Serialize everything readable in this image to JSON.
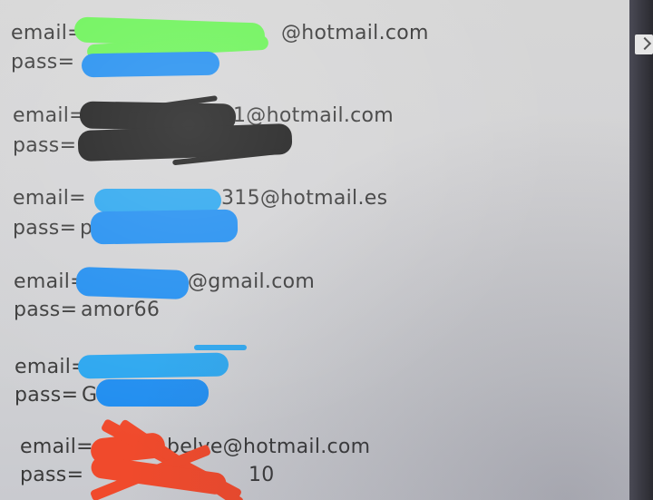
{
  "records": [
    {
      "email_label": "email=",
      "email_tail": "@hotmail.com",
      "pass_label": "pass=",
      "pass_value": "",
      "redaction_color": "#6af356"
    },
    {
      "email_label": "email=",
      "email_tail": "1@hotmail.com",
      "pass_label": "pass=",
      "pass_value": "",
      "redaction_color": "#1a1a1a"
    },
    {
      "email_label": "email=",
      "email_tail": "315@hotmail.es",
      "pass_label": "pass=",
      "pass_value": "p",
      "redaction_color": "#1f8df0"
    },
    {
      "email_label": "email=",
      "email_tail": "@gmail.com",
      "pass_label": "pass=",
      "pass_value": "amor66",
      "redaction_color": "#1f8df0"
    },
    {
      "email_label": "email=",
      "email_tail": "",
      "pass_label": "pass=",
      "pass_value": "G",
      "redaction_color": "#2aa6ef"
    },
    {
      "email_label": "email=",
      "email_tail": "belve@hotmail.com",
      "pass_label": "pass=",
      "pass_value": "10",
      "redaction_color": "#f04a2c"
    }
  ]
}
